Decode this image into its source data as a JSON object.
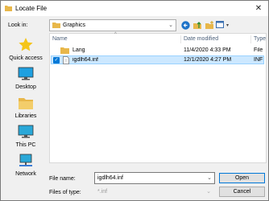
{
  "window": {
    "title": "Locate File",
    "close_symbol": "✕"
  },
  "lookin": {
    "label": "Look in:",
    "value": "Graphics"
  },
  "places": [
    {
      "label": "Quick access",
      "icon": "star-icon"
    },
    {
      "label": "Desktop",
      "icon": "desktop-icon"
    },
    {
      "label": "Libraries",
      "icon": "libraries-icon"
    },
    {
      "label": "This PC",
      "icon": "computer-icon"
    },
    {
      "label": "Network",
      "icon": "network-icon"
    }
  ],
  "columns": {
    "name": "Name",
    "date": "Date modified",
    "type": "Type"
  },
  "files": [
    {
      "name": "Lang",
      "date": "11/4/2020 4:33 PM",
      "type": "File fo",
      "kind": "folder",
      "selected": false
    },
    {
      "name": "igdlh64.inf",
      "date": "12/1/2020 4:27 PM",
      "type": "INF F",
      "kind": "file",
      "selected": true
    }
  ],
  "filename": {
    "label": "File name:",
    "value": "igdlh64.inf"
  },
  "filetype": {
    "label": "Files of type:",
    "value": "*.inf"
  },
  "buttons": {
    "open": "Open",
    "cancel": "Cancel"
  },
  "colors": {
    "accent": "#0078d7",
    "selection": "#cce8ff",
    "folder": "#e8b74a"
  }
}
